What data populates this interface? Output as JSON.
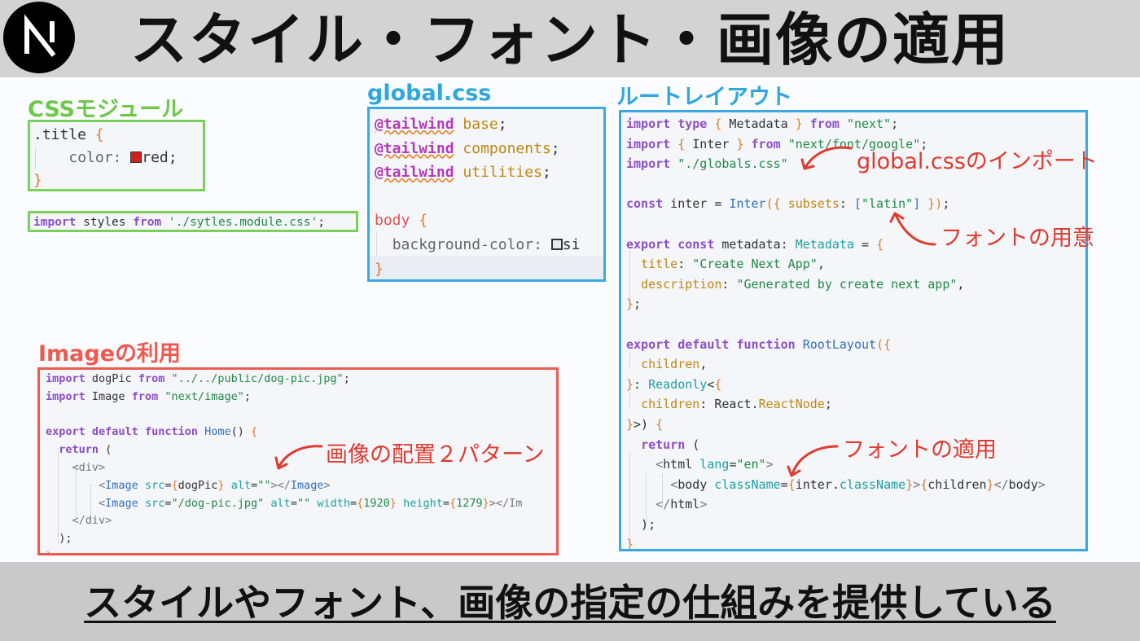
{
  "header": {
    "title": "スタイル・フォント・画像の適用",
    "logo_letter": "N"
  },
  "sections": {
    "css_module": "CSSモジュール",
    "global_css": "global.css",
    "root_layout": "ルートレイアウト",
    "image": "Imageの利用"
  },
  "css_module": {
    "lines": [
      ".title {",
      "color:",
      "red;",
      "}"
    ],
    "swatch_color": "#d11f1f",
    "import_line": "import styles from './sytles.module.css';"
  },
  "global_css": {
    "lines": [
      "@tailwind base;",
      "@tailwind components;",
      "@tailwind utilities;",
      "",
      "body {",
      "background-color:",
      "si",
      "}"
    ]
  },
  "root_layout": {
    "code": [
      "import type { Metadata } from \"next\";",
      "import { Inter } from \"next/font/google\";",
      "import \"./globals.css\"",
      "",
      "const inter = Inter({ subsets: [\"latin\"] });",
      "",
      "export const metadata: Metadata = {",
      "  title: \"Create Next App\",",
      "  description: \"Generated by create next app\",",
      "};",
      "",
      "export default function RootLayout({",
      "  children,",
      "}: Readonly<{",
      "  children: React.ReactNode;",
      "}>) {",
      "  return (",
      "    <html lang=\"en\">",
      "      <body className={inter.className}>{children}</body>",
      "    </html>",
      "  );",
      "}"
    ]
  },
  "image_code": {
    "code": [
      "import dogPic from \"../../public/dog-pic.jpg\";",
      "import Image from \"next/image\";",
      "",
      "export default function Home() {",
      "  return (",
      "    <div>",
      "        <Image src={dogPic} alt=\"\"></Image>",
      "        <Image src=\"/dog-pic.jpg\" alt=\"\" width={1920} height={1279}></Im",
      "    </div>",
      "  );",
      "}"
    ]
  },
  "annotations": {
    "global_import": "global.cssのインポート",
    "font_prepare": "フォントの用意",
    "font_apply": "フォントの適用",
    "image_placement": "画像の配置２パターン"
  },
  "footer": {
    "text": "スタイルやフォント、画像の指定の仕組みを提供している"
  },
  "colors": {
    "green_frame": "#7ad15a",
    "blue_frame": "#3aa9e1",
    "red_frame": "#ec5a50",
    "annotation": "#e03a2e"
  }
}
